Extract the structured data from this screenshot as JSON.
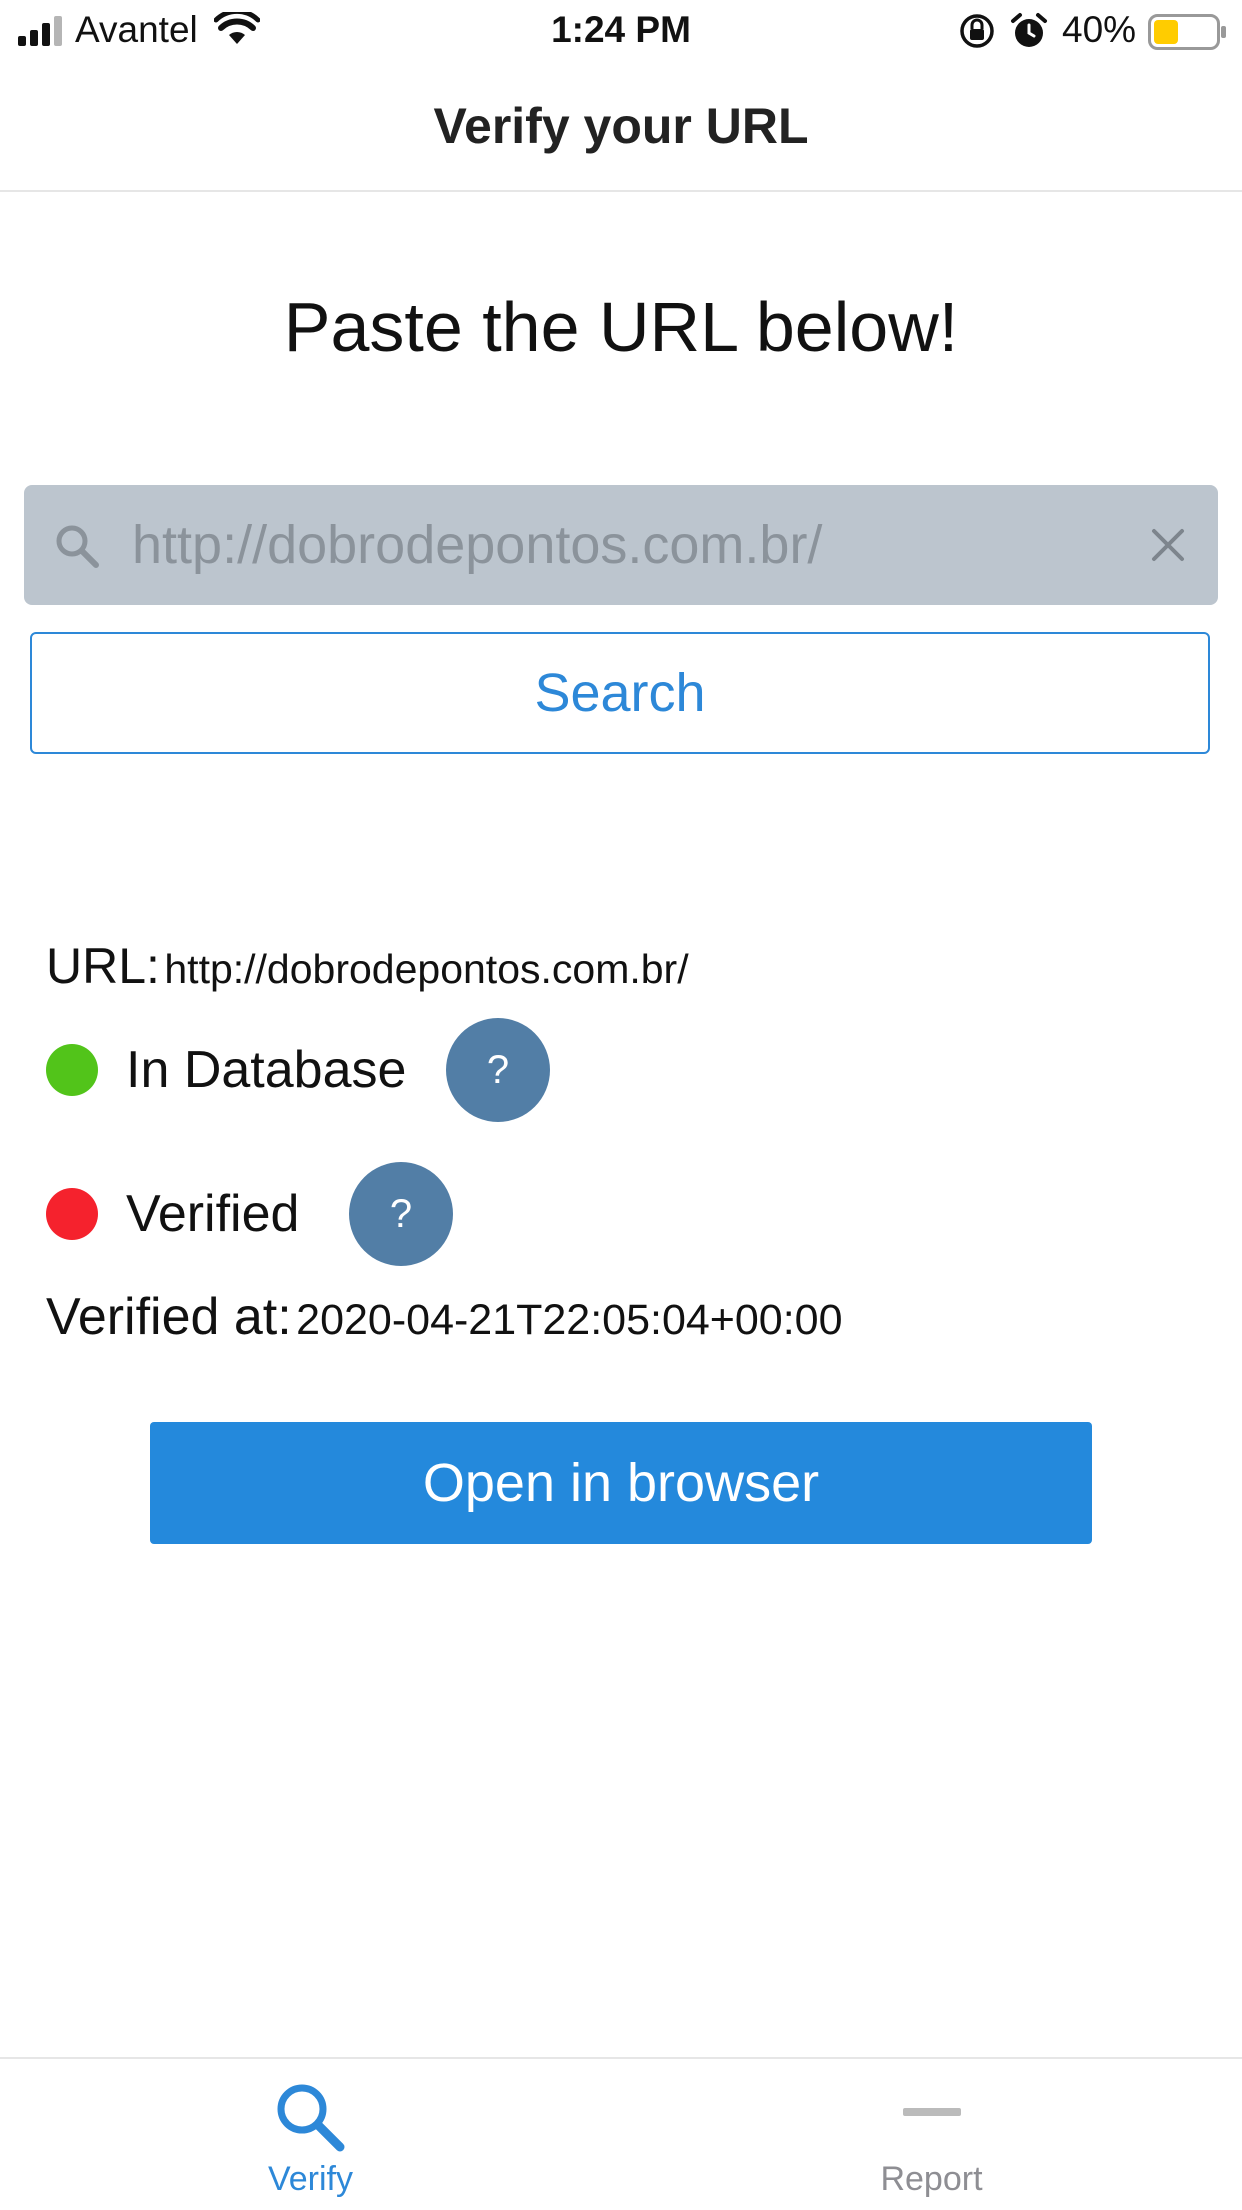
{
  "status_bar": {
    "carrier": "Avantel",
    "time": "1:24 PM",
    "battery_percent": "40%",
    "battery_level": 0.4,
    "battery_color": "#ffcc00"
  },
  "header": {
    "title": "Verify your URL"
  },
  "main": {
    "heading": "Paste the URL below!",
    "search": {
      "icon": "search-icon",
      "placeholder": "http://dobrodepontos.com.br/",
      "value": "",
      "clear_icon": "close-icon"
    },
    "search_button_label": "Search",
    "result": {
      "url_label": "URL:",
      "url_value": "http://dobrodepontos.com.br/",
      "statuses": [
        {
          "label": "In Database",
          "color": "#52c41a",
          "help_label": "?"
        },
        {
          "label": "Verified",
          "color": "#f5222d",
          "help_label": "?"
        }
      ],
      "verified_at_label": "Verified at:",
      "verified_at_value": "2020-04-21T22:05:04+00:00"
    },
    "open_button_label": "Open in browser"
  },
  "tab_bar": {
    "tabs": [
      {
        "label": "Verify",
        "icon": "search-icon",
        "active": true,
        "color": "#2d88d8"
      },
      {
        "label": "Report",
        "icon": "minus-icon",
        "active": false,
        "color": "#8e8e93"
      }
    ]
  },
  "colors": {
    "accent": "#2489dc",
    "help_button": "#527ea6",
    "search_bar_bg": "#bcc5ce"
  }
}
